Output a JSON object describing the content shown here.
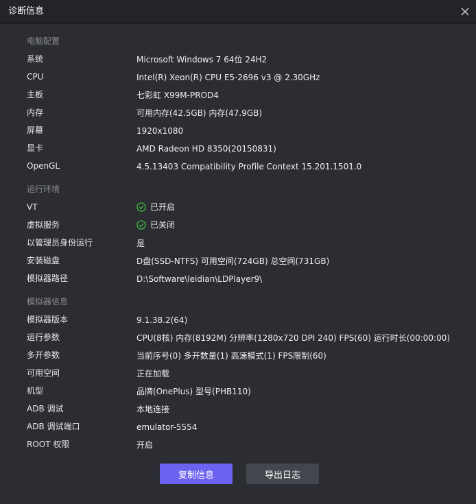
{
  "window": {
    "title": "诊断信息",
    "close_icon": "close-icon"
  },
  "sections": {
    "computer": {
      "header": "电脑配置",
      "rows": [
        {
          "label": "系统",
          "value": "Microsoft Windows 7 64位 24H2"
        },
        {
          "label": "CPU",
          "value": "Intel(R) Xeon(R) CPU E5-2696 v3 @ 2.30GHz"
        },
        {
          "label": "主板",
          "value": "七彩虹 X99M-PROD4"
        },
        {
          "label": "内存",
          "value": "可用内存(42.5GB) 内存(47.9GB)"
        },
        {
          "label": "屏幕",
          "value": "1920x1080"
        },
        {
          "label": "显卡",
          "value": "AMD Radeon HD 8350(20150831)"
        },
        {
          "label": "OpenGL",
          "value": "4.5.13403 Compatibility Profile Context 15.201.1501.0"
        }
      ]
    },
    "runtime": {
      "header": "运行环境",
      "rows": [
        {
          "label": "VT",
          "value": "已开启",
          "icon": "check-circle-icon"
        },
        {
          "label": "虚拟服务",
          "value": "已关闭",
          "icon": "check-circle-icon"
        },
        {
          "label": "以管理员身份运行",
          "value": "是"
        },
        {
          "label": "安装磁盘",
          "value": "D盘(SSD-NTFS) 可用空间(724GB) 总空间(731GB)"
        },
        {
          "label": "模拟器路径",
          "value": "D:\\Software\\leidian\\LDPlayer9\\"
        }
      ]
    },
    "emulator": {
      "header": "模拟器信息",
      "rows": [
        {
          "label": "模拟器版本",
          "value": "9.1.38.2(64)"
        },
        {
          "label": "运行参数",
          "value": "CPU(8核) 内存(8192M) 分辨率(1280x720 DPI 240) FPS(60) 运行时长(00:00:00)"
        },
        {
          "label": "多开参数",
          "value": "当前序号(0) 多开数量(1) 高速模式(1) FPS限制(60)"
        },
        {
          "label": "可用空间",
          "value": "正在加载"
        },
        {
          "label": "机型",
          "value": "品牌(OnePlus) 型号(PHB110)"
        },
        {
          "label": "ADB 调试",
          "value": "本地连接"
        },
        {
          "label": "ADB 调试端口",
          "value": "emulator-5554"
        },
        {
          "label": "ROOT 权限",
          "value": "开启"
        }
      ]
    }
  },
  "buttons": {
    "copy_label": "复制信息",
    "export_label": "导出日志"
  },
  "colors": {
    "background": "#2b2d33",
    "titlebar": "#222429",
    "accent": "#6c63f0",
    "secondary_button": "#44464d",
    "check_green": "#3fbf3f",
    "section_header": "#8a8c92"
  }
}
